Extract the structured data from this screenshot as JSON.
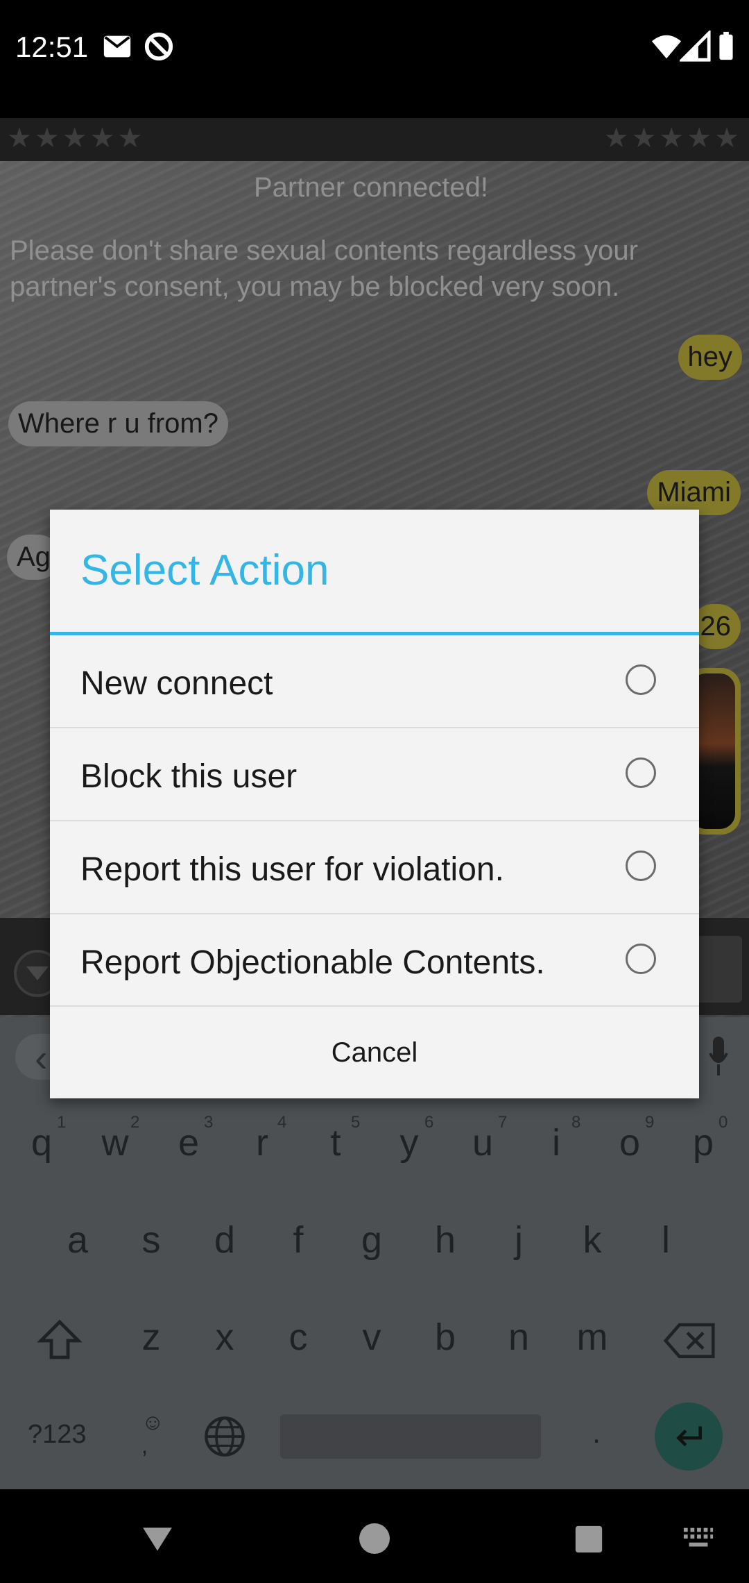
{
  "status_bar": {
    "time": "12:51",
    "left_icons": [
      "gmail-icon",
      "do-not-disturb-icon"
    ],
    "right_icons": [
      "wifi-icon",
      "signal-icon",
      "battery-icon"
    ]
  },
  "chat": {
    "stars_left": "★★★★★",
    "stars_right": "★★★★★",
    "system_message": "Partner connected!",
    "warning": "Please don't share sexual contents regardless your partner's consent, you may be blocked very soon.",
    "messages": [
      {
        "from": "me",
        "text": "hey"
      },
      {
        "from": "partner",
        "text": "Where r u from?"
      },
      {
        "from": "me",
        "text": "Miami"
      },
      {
        "from": "partner",
        "text": "Ag"
      },
      {
        "from": "me",
        "text": "26"
      }
    ]
  },
  "dialog": {
    "title": "Select Action",
    "options": [
      {
        "label": "New connect",
        "selected": false
      },
      {
        "label": "Block this user",
        "selected": false
      },
      {
        "label": "Report this user for violation.",
        "selected": false
      },
      {
        "label": "Report Objectionable Contents.",
        "selected": false
      }
    ],
    "cancel_label": "Cancel"
  },
  "keyboard": {
    "row1": [
      {
        "key": "q",
        "num": "1"
      },
      {
        "key": "w",
        "num": "2"
      },
      {
        "key": "e",
        "num": "3"
      },
      {
        "key": "r",
        "num": "4"
      },
      {
        "key": "t",
        "num": "5"
      },
      {
        "key": "y",
        "num": "6"
      },
      {
        "key": "u",
        "num": "7"
      },
      {
        "key": "i",
        "num": "8"
      },
      {
        "key": "o",
        "num": "9"
      },
      {
        "key": "p",
        "num": "0"
      }
    ],
    "row2": [
      "a",
      "s",
      "d",
      "f",
      "g",
      "h",
      "j",
      "k",
      "l"
    ],
    "row3": [
      "z",
      "x",
      "c",
      "v",
      "b",
      "n",
      "m"
    ],
    "symbols_label": "?123",
    "emoji_label": "☺,",
    "period_label": "."
  },
  "colors": {
    "accent": "#33b5e5",
    "my_bubble": "#b4a93a",
    "partner_bubble": "#a9a9a9",
    "enter_key": "#2b6a60"
  }
}
